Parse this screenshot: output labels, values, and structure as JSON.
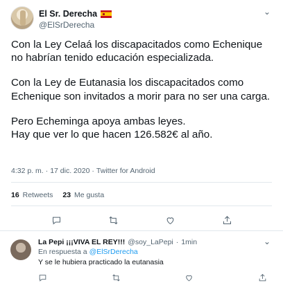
{
  "tweet": {
    "display_name": "El Sr. Derecha",
    "handle": "@ElSrDerecha",
    "paragraphs": [
      "Con la Ley Celaá los discapacitados como Echenique no habrían tenido educación especializada.",
      "Con la Ley de Eutanasia los discapacitados como Echenique son invitados a morir para no ser una carga.",
      "Pero Echeminga apoya ambas leyes.\nHay que ver lo que hacen 126.582€ al año."
    ],
    "time": "4:32 p. m.",
    "date": "17 dic. 2020",
    "source": "Twitter for Android",
    "meta_separator": "·",
    "retweets_count": "16",
    "retweets_label": "Retweets",
    "likes_count": "23",
    "likes_label": "Me gusta"
  },
  "reply": {
    "display_name": "La Pepi ¡¡¡VIVA EL REY!!!",
    "handle": "@soy_LaPepi",
    "separator": "·",
    "time": "1min",
    "in_reply_prefix": "En respuesta a",
    "in_reply_handle": "@ElSrDerecha",
    "text": "Y se le hubiera practicado la eutanasia"
  },
  "icons": {
    "more": "chevron-down-icon",
    "reply": "reply-icon",
    "retweet": "retweet-icon",
    "like": "heart-icon",
    "share": "share-icon"
  },
  "colors": {
    "text": "#0f1419",
    "muted": "#536471",
    "link": "#1d9bf0",
    "divider": "#e1e8ed"
  }
}
